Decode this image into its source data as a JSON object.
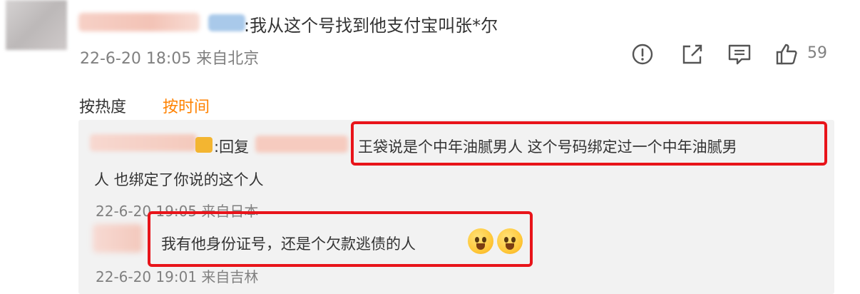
{
  "main_comment": {
    "text": ":我从这个号找到他支付宝叫张*尔",
    "meta": "22-6-20 18:05 来自北京",
    "like_count": "59",
    "actions": [
      "report-icon",
      "share-icon",
      "comment-icon",
      "like-icon"
    ]
  },
  "sort_tabs": {
    "hot": "按热度",
    "time": "按时间",
    "active_color": "#ff8200"
  },
  "replies": [
    {
      "prefix": ":回复",
      "text_line1": "王袋说是个中年油腻男人 这个号码绑定过一个中年油腻男",
      "text_line2": "人 也绑定了你说的这个人",
      "meta": "22-6-20 19:05 来自日本"
    },
    {
      "text": "我有他身份证号，还是个欠款逃债的人",
      "emoji": "scared-face-icon",
      "meta": "22-6-20 19:01 来自吉林"
    }
  ],
  "colors": {
    "highlight_border": "#e8141a",
    "meta_text": "#808080",
    "reply_background": "#f2f2f2"
  }
}
